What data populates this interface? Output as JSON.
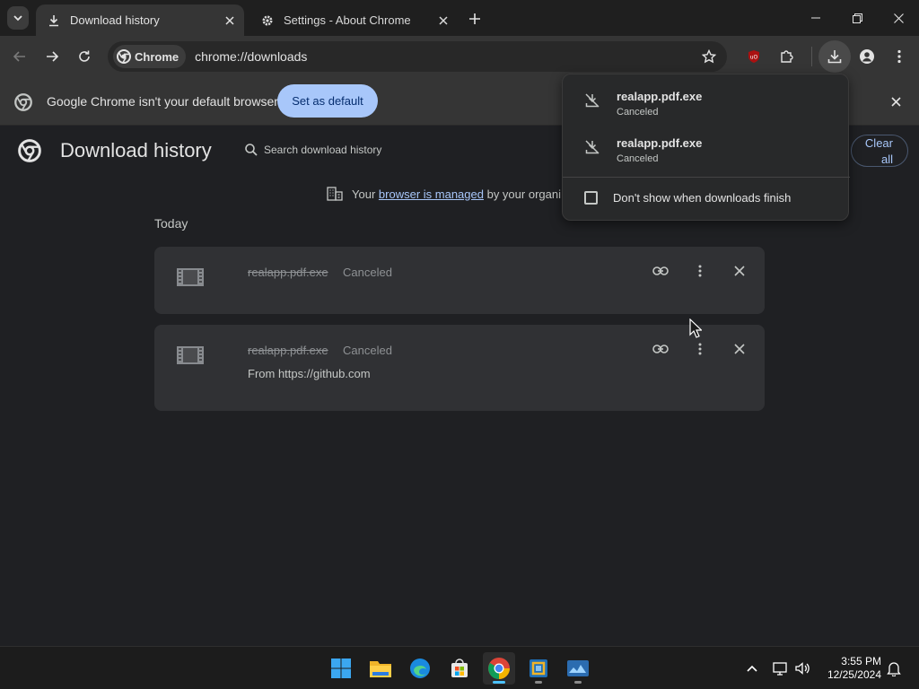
{
  "tabs": [
    {
      "title": "Download history",
      "icon": "download-icon"
    },
    {
      "title": "Settings - About Chrome",
      "icon": "gear-icon"
    }
  ],
  "toolbar": {
    "chip_label": "Chrome",
    "url": "chrome://downloads"
  },
  "infobar": {
    "message": "Google Chrome isn't your default browser",
    "button": "Set as default"
  },
  "page": {
    "title": "Download history",
    "search_placeholder": "Search download history",
    "clear_all": "Clear all",
    "managed_prefix": "Your",
    "managed_link": "browser is managed",
    "managed_suffix": "by your organi",
    "section": "Today",
    "items": [
      {
        "filename": "realapp.pdf.exe",
        "status": "Canceled",
        "from": ""
      },
      {
        "filename": "realapp.pdf.exe",
        "status": "Canceled",
        "from": "From https://github.com"
      }
    ]
  },
  "bubble": {
    "items": [
      {
        "filename": "realapp.pdf.exe",
        "status": "Canceled"
      },
      {
        "filename": "realapp.pdf.exe",
        "status": "Canceled"
      }
    ],
    "checkbox_label": "Don't show when downloads finish",
    "checkbox_checked": false
  },
  "taskbar": {
    "time": "3:55 PM",
    "date": "12/25/2024"
  },
  "colors": {
    "accent": "#a8c7fa",
    "page_bg": "#1f2023",
    "card_bg": "#303134",
    "toolbar_bg": "#353535"
  }
}
